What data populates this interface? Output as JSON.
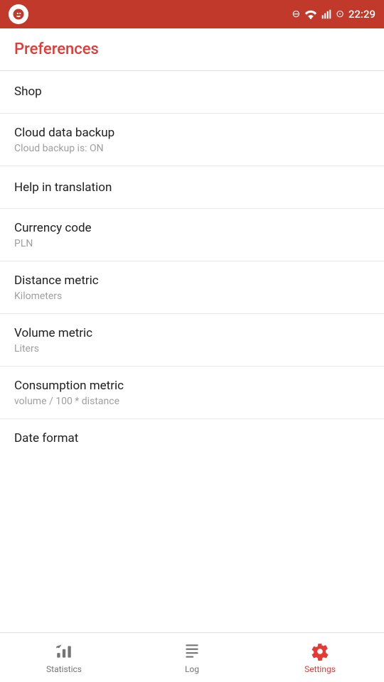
{
  "statusBar": {
    "time": "22:29"
  },
  "header": {
    "title": "Preferences"
  },
  "menuItems": [
    {
      "id": "shop",
      "title": "Shop",
      "subtitle": null
    },
    {
      "id": "cloud-data-backup",
      "title": "Cloud data backup",
      "subtitle": "Cloud backup is: ON"
    },
    {
      "id": "help-in-translation",
      "title": "Help in translation",
      "subtitle": null
    },
    {
      "id": "currency-code",
      "title": "Currency code",
      "subtitle": "PLN"
    },
    {
      "id": "distance-metric",
      "title": "Distance metric",
      "subtitle": "Kilometers"
    },
    {
      "id": "volume-metric",
      "title": "Volume metric",
      "subtitle": "Liters"
    },
    {
      "id": "consumption-metric",
      "title": "Consumption metric",
      "subtitle": "volume / 100 * distance"
    }
  ],
  "partialItem": {
    "title": "Date format"
  },
  "bottomNav": {
    "items": [
      {
        "id": "statistics",
        "label": "Statistics",
        "active": false
      },
      {
        "id": "log",
        "label": "Log",
        "active": false
      },
      {
        "id": "settings",
        "label": "Settings",
        "active": true
      }
    ]
  }
}
